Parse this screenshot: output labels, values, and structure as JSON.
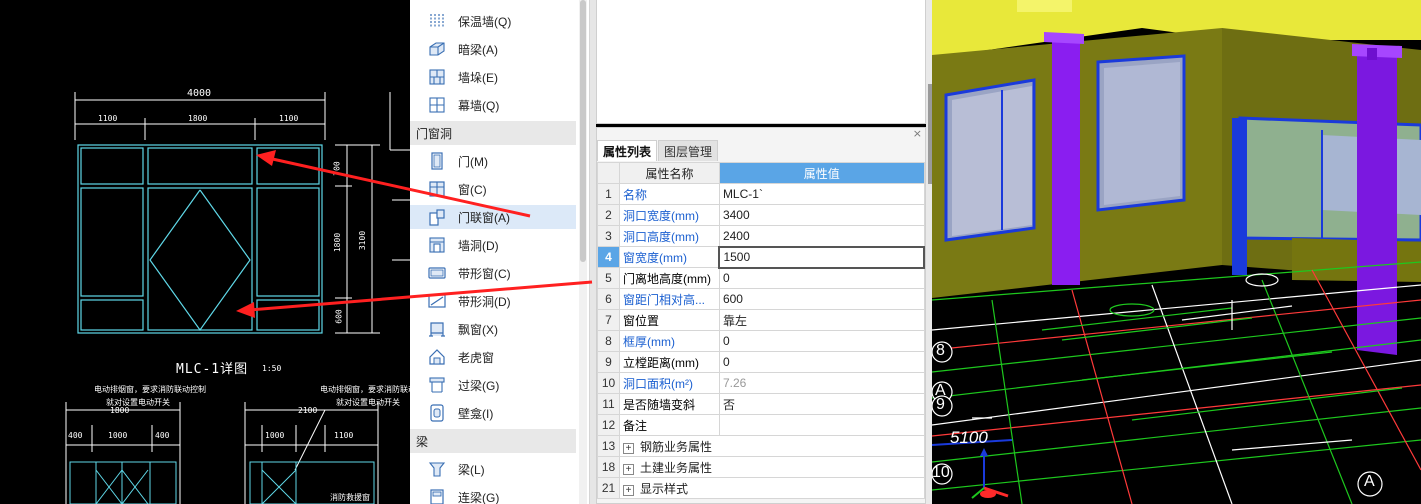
{
  "cad": {
    "dim_total": "4000",
    "dim_left": "1100",
    "dim_mid": "1800",
    "dim_right": "1100",
    "dim_v_top": "700",
    "dim_v_mid": "1800",
    "dim_v_total": "3100",
    "dim_v_bottom": "600",
    "detail_title": "MLC-1详图",
    "detail_scale": "1:50",
    "note_left_1": "电动排烟窗，要求消防联动控制",
    "note_left_2": "就对设置电动开关",
    "note_right_1": "电动排烟窗，要求消防联动",
    "note_right_2": "就对设置电动开关",
    "lower_dim_1": "1800",
    "lower_dim_2": "400",
    "lower_dim_3": "1000",
    "lower_dim_4": "400",
    "lower_dim_5": "2100",
    "lower_dim_6": "1000",
    "lower_dim_7": "1100",
    "lower_note": "消防救援窗"
  },
  "menu": {
    "items": [
      {
        "label": "保温墙(Q)",
        "icon": "insulation-wall-icon"
      },
      {
        "label": "暗梁(A)",
        "icon": "hidden-beam-icon"
      },
      {
        "label": "墙垛(E)",
        "icon": "wall-pier-icon"
      },
      {
        "label": "幕墙(Q)",
        "icon": "curtain-wall-icon"
      },
      {
        "label": "门(M)",
        "icon": "door-icon"
      },
      {
        "label": "窗(C)",
        "icon": "window-icon"
      },
      {
        "label": "门联窗(A)",
        "icon": "door-window-icon"
      },
      {
        "label": "墙洞(D)",
        "icon": "wall-opening-icon"
      },
      {
        "label": "带形窗(C)",
        "icon": "strip-window-icon"
      },
      {
        "label": "带形洞(D)",
        "icon": "strip-opening-icon"
      },
      {
        "label": "飘窗(X)",
        "icon": "bay-window-icon"
      },
      {
        "label": "老虎窗",
        "icon": "dormer-window-icon"
      },
      {
        "label": "过梁(G)",
        "icon": "lintel-icon"
      },
      {
        "label": "壁龛(I)",
        "icon": "niche-icon"
      },
      {
        "label": "梁(L)",
        "icon": "beam-icon"
      },
      {
        "label": "连梁(G)",
        "icon": "coupling-beam-icon"
      }
    ],
    "categories": [
      "门窗洞",
      "梁"
    ]
  },
  "props": {
    "close": "×",
    "tabs": [
      "属性列表",
      "图层管理"
    ],
    "col_name": "属性名称",
    "col_value": "属性值",
    "rows": [
      {
        "num": "1",
        "name": "名称",
        "value": "MLC-1`"
      },
      {
        "num": "2",
        "name": "洞口宽度(mm)",
        "value": "3400"
      },
      {
        "num": "3",
        "name": "洞口高度(mm)",
        "value": "2400"
      },
      {
        "num": "4",
        "name": "窗宽度(mm)",
        "value": "1500"
      },
      {
        "num": "5",
        "name": "门离地高度(mm)",
        "value": "0"
      },
      {
        "num": "6",
        "name": "窗距门相对高...",
        "value": "600"
      },
      {
        "num": "7",
        "name": "窗位置",
        "value": "靠左"
      },
      {
        "num": "8",
        "name": "框厚(mm)",
        "value": "0"
      },
      {
        "num": "9",
        "name": "立樘距离(mm)",
        "value": "0"
      },
      {
        "num": "10",
        "name": "洞口面积(m²)",
        "value": "7.26"
      },
      {
        "num": "11",
        "name": "是否随墙变斜",
        "value": "否"
      },
      {
        "num": "12",
        "name": "备注",
        "value": ""
      }
    ],
    "groups": [
      {
        "num": "13",
        "sign": "+",
        "name": "钢筋业务属性"
      },
      {
        "num": "18",
        "sign": "+",
        "name": "土建业务属性"
      },
      {
        "num": "21",
        "sign": "+",
        "name": "显示样式"
      }
    ]
  },
  "view3d": {
    "axis_8": "8",
    "axis_a1": "A",
    "axis_9": "9",
    "dim_5100": "5100",
    "axis_10": "10",
    "axis_a2": "A"
  }
}
